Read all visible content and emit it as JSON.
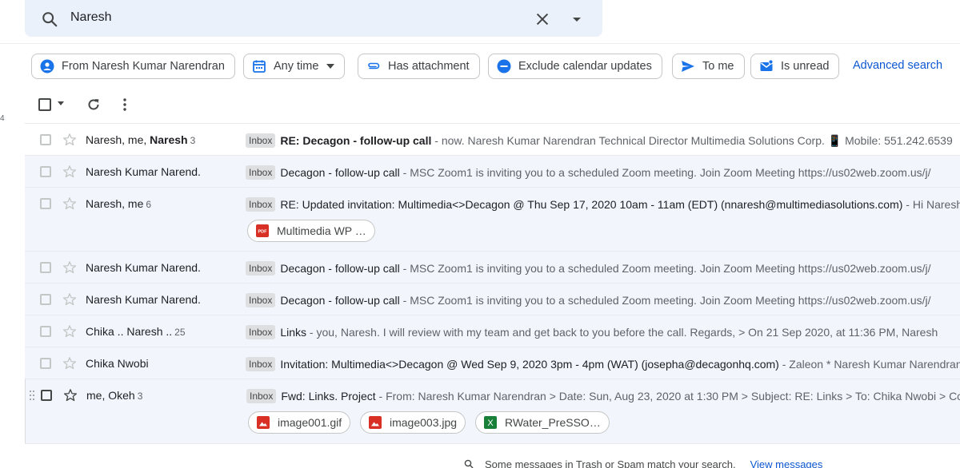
{
  "search": {
    "query": "Naresh"
  },
  "filters": {
    "chips": [
      {
        "label": "From Naresh Kumar Narendran",
        "icon": "person-circle-icon"
      },
      {
        "label": "Any time",
        "icon": "calendar-icon"
      },
      {
        "label": "Has attachment",
        "icon": "paperclip-icon"
      },
      {
        "label": "Exclude calendar updates",
        "icon": "minus-circle-icon"
      },
      {
        "label": "To me",
        "icon": "send-icon"
      },
      {
        "label": "Is unread",
        "icon": "envelope-icon"
      }
    ],
    "advanced_search": "Advanced search"
  },
  "side_mark": "4",
  "messages": [
    {
      "sender_pre": "Naresh, me, ",
      "sender_bold": "Naresh",
      "count": "3",
      "label": "Inbox",
      "subject": "RE: Decagon - follow-up call",
      "snippet": " - now. Naresh Kumar Narendran Technical Director Multimedia Solutions Corp. 📱 Mobile: 551.242.6539"
    },
    {
      "sender_pre": "Naresh Kumar Narend.",
      "sender_bold": "",
      "count": "",
      "label": "Inbox",
      "subject": "Decagon - follow-up call",
      "snippet": " - MSC Zoom1 is inviting you to a scheduled Zoom meeting. Join Zoom Meeting https://us02web.zoom.us/j/"
    },
    {
      "sender_pre": "Naresh, me",
      "sender_bold": "",
      "count": "6",
      "label": "Inbox",
      "subject": "RE: Updated invitation: Multimedia<>Decagon @ Thu Sep 17, 2020 10am - 11am (EDT) (nnaresh@multimediasolutions.com)",
      "snippet": " - Hi Naresh",
      "attachments": [
        {
          "name": "Multimedia WP …",
          "icon": "pdf-icon"
        }
      ]
    },
    {
      "sender_pre": "Naresh Kumar Narend.",
      "sender_bold": "",
      "count": "",
      "label": "Inbox",
      "subject": "Decagon - follow-up call",
      "snippet": " - MSC Zoom1 is inviting you to a scheduled Zoom meeting. Join Zoom Meeting https://us02web.zoom.us/j/"
    },
    {
      "sender_pre": "Naresh Kumar Narend.",
      "sender_bold": "",
      "count": "",
      "label": "Inbox",
      "subject": "Decagon - follow-up call",
      "snippet": " - MSC Zoom1 is inviting you to a scheduled Zoom meeting. Join Zoom Meeting https://us02web.zoom.us/j/"
    },
    {
      "sender_pre": "Chika .. Naresh ..",
      "sender_bold": "",
      "count": "25",
      "label": "Inbox",
      "subject": "Links",
      "snippet": " - you, Naresh. I will review with my team and get back to you before the call. Regards, > On 21 Sep 2020, at 11:36 PM, Naresh"
    },
    {
      "sender_pre": "Chika Nwobi",
      "sender_bold": "",
      "count": "",
      "label": "Inbox",
      "subject": "Invitation: Multimedia<>Decagon @ Wed Sep 9, 2020 3pm - 4pm (WAT) (josepha@decagonhq.com)",
      "snippet": " - Zaleon * Naresh Kumar Narendran"
    },
    {
      "sender_pre": "me, Okeh",
      "sender_bold": "",
      "count": "3",
      "label": "Inbox",
      "subject": "Fwd: Links. Project",
      "snippet": " - From: Naresh Kumar Narendran > Date: Sun, Aug 23, 2020 at 1:30 PM > Subject: RE: Links > To: Chika Nwobi > Cc:",
      "attachments": [
        {
          "name": "image001.gif",
          "icon": "image-icon"
        },
        {
          "name": "image003.jpg",
          "icon": "image-icon"
        },
        {
          "name": "RWater_PreSSO…",
          "icon": "spreadsheet-icon"
        }
      ]
    }
  ],
  "footer": {
    "text": "Some messages in Trash or Spam match your search.",
    "link": "View messages"
  },
  "colors": {
    "accent": "#0b57d0",
    "search_bg": "#eaf1fb",
    "read_row_bg": "#f2f6fc"
  }
}
